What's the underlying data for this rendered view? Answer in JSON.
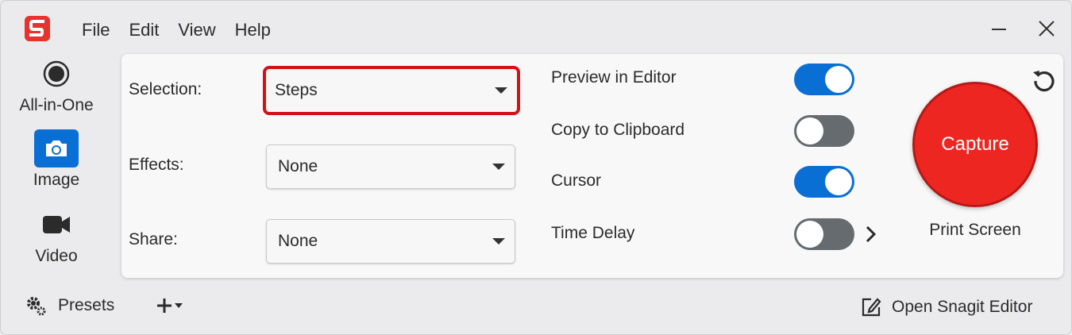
{
  "menu": {
    "file": "File",
    "edit": "Edit",
    "view": "View",
    "help": "Help"
  },
  "modes": {
    "all_in_one": "All-in-One",
    "image": "Image",
    "video": "Video",
    "active": "Image"
  },
  "settings": {
    "selection_label": "Selection:",
    "selection_value": "Steps",
    "effects_label": "Effects:",
    "effects_value": "None",
    "share_label": "Share:",
    "share_value": "None"
  },
  "toggles": [
    {
      "label": "Preview in Editor",
      "on": true
    },
    {
      "label": "Copy to Clipboard",
      "on": false
    },
    {
      "label": "Cursor",
      "on": true
    },
    {
      "label": "Time Delay",
      "on": false
    }
  ],
  "capture": {
    "label": "Capture",
    "shortcut": "Print Screen"
  },
  "footer": {
    "presets": "Presets",
    "open_editor": "Open Snagit Editor"
  },
  "colors": {
    "accent_blue": "#0a6fd4",
    "capture_red": "#ee2622",
    "highlight_red": "#d70f17",
    "logo_red": "#e8322b"
  }
}
